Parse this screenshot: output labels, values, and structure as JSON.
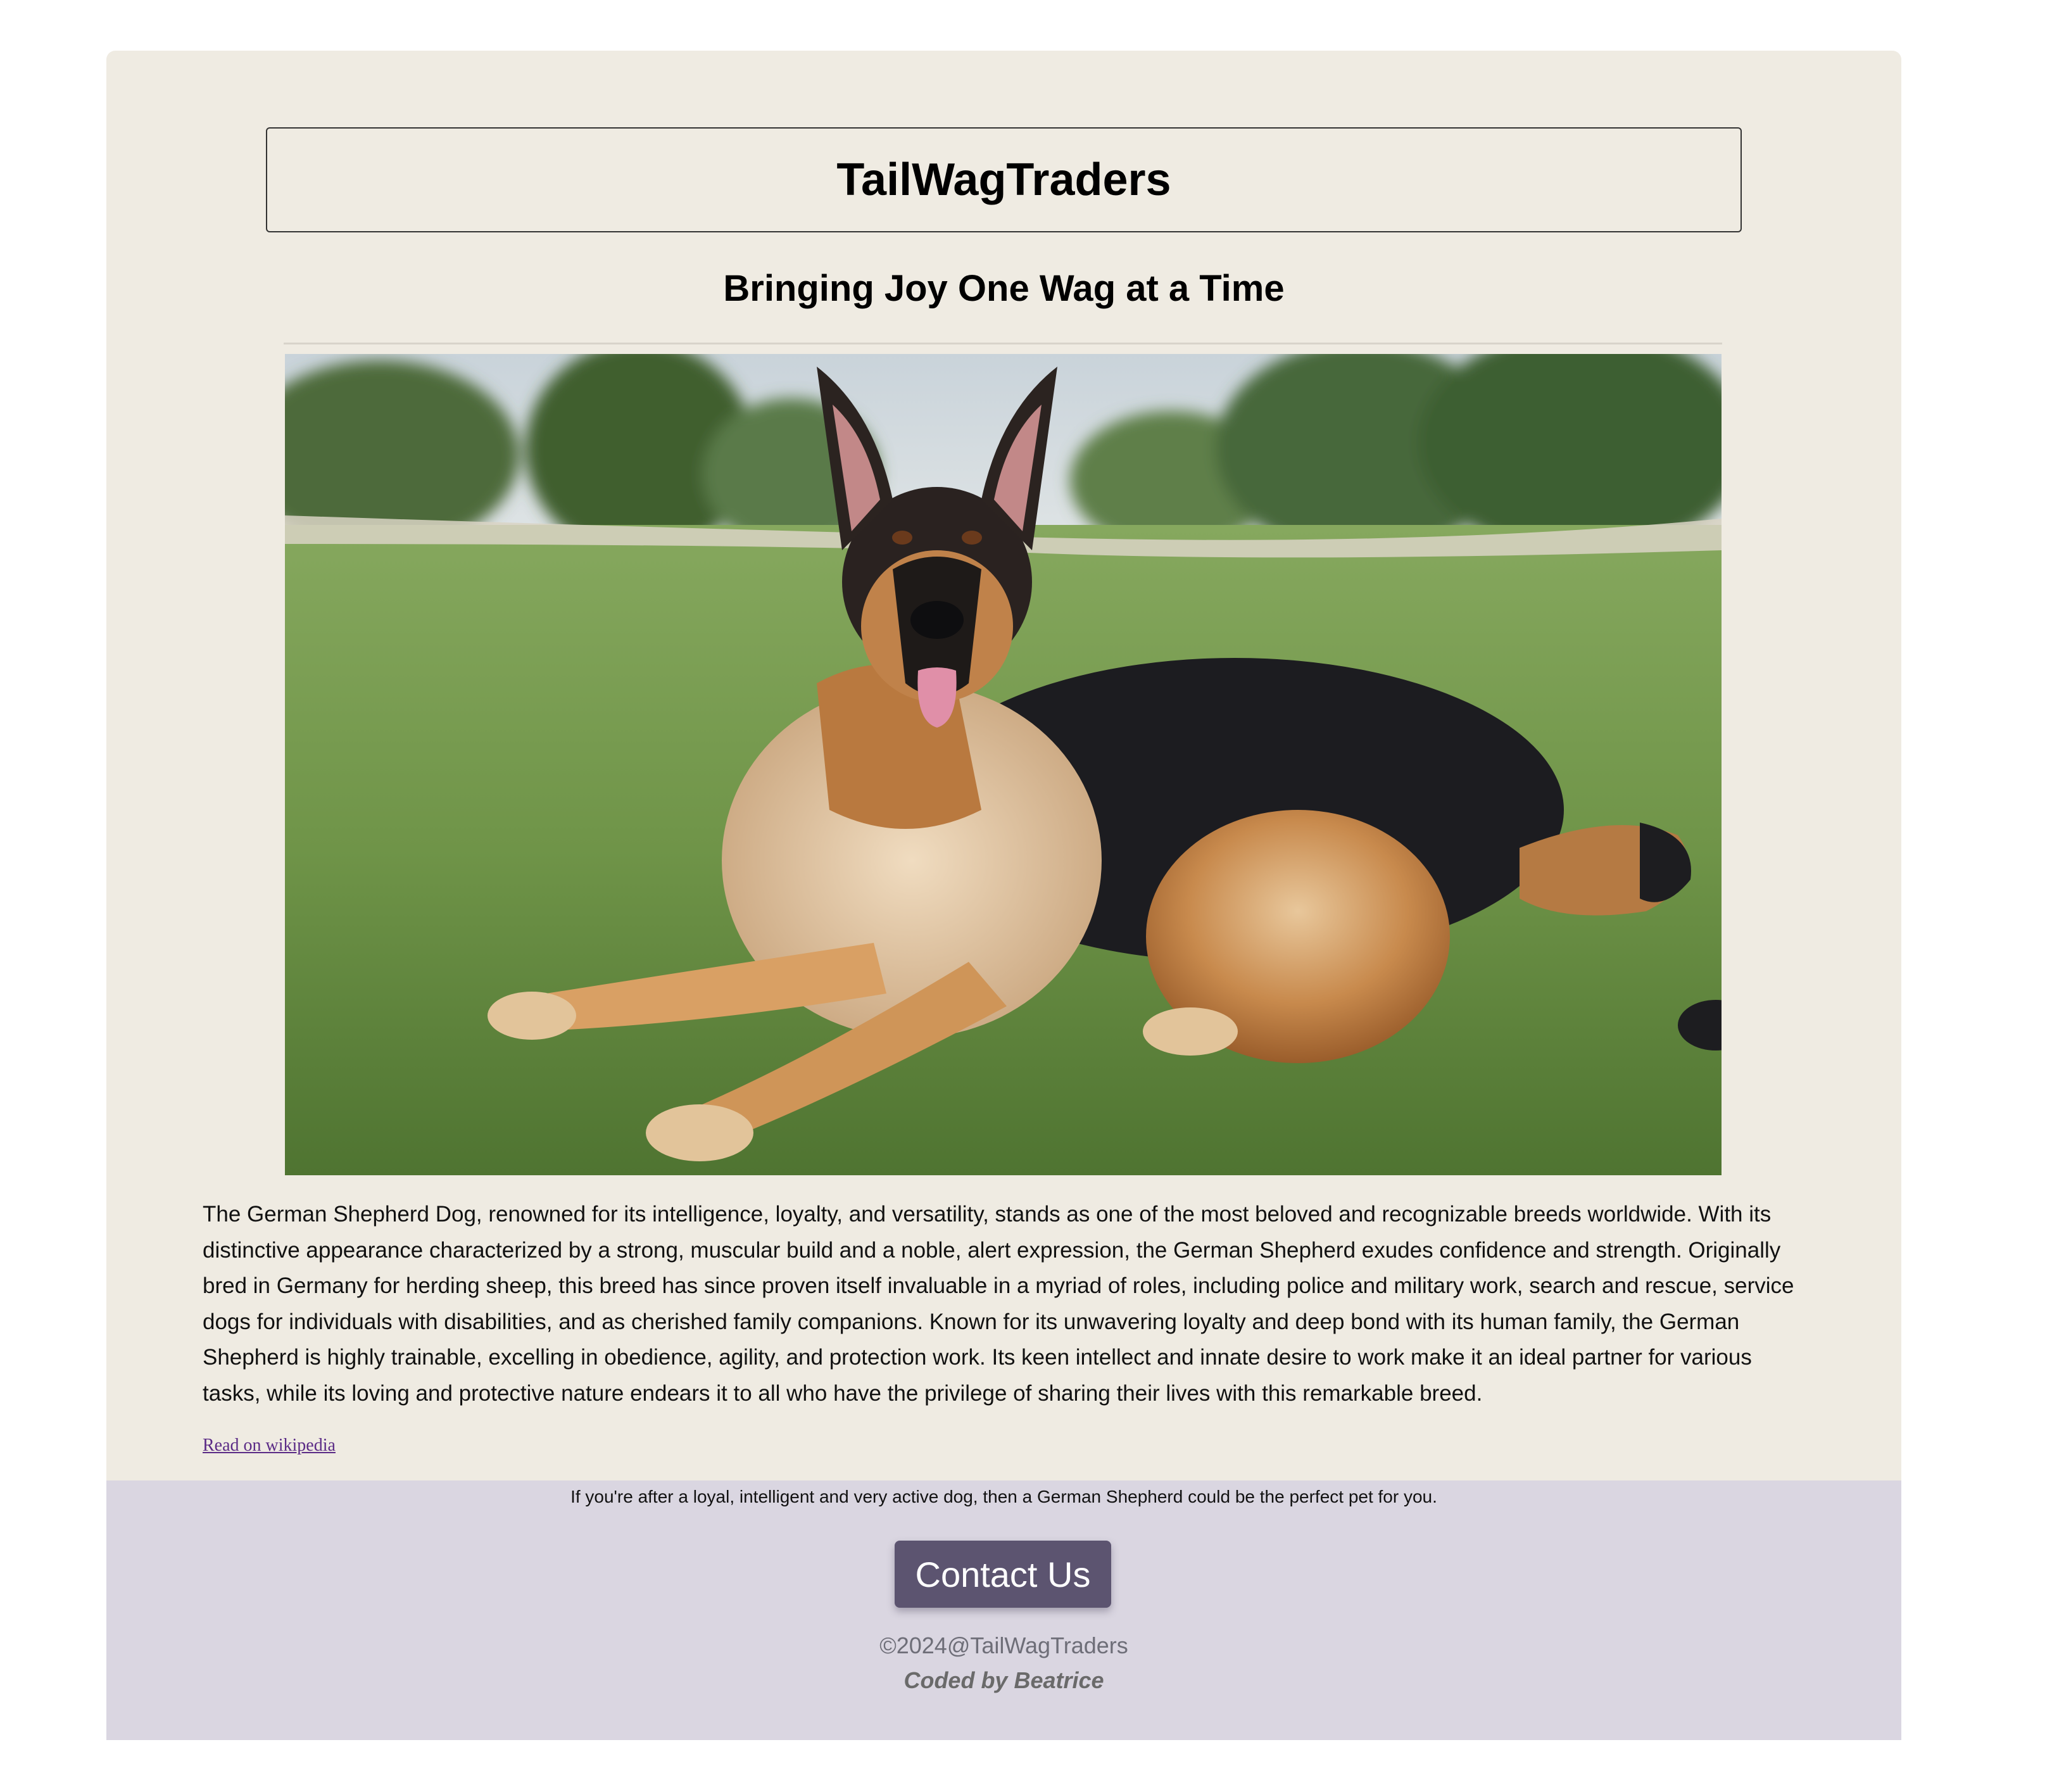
{
  "header": {
    "brand": "TailWagTraders",
    "tagline": "Bringing Joy One Wag at a Time"
  },
  "hero": {
    "alt": "German Shepherd dog lying on grass"
  },
  "main": {
    "description": "The German Shepherd Dog, renowned for its intelligence, loyalty, and versatility, stands as one of the most beloved and recognizable breeds worldwide. With its distinctive appearance characterized by a strong, muscular build and a noble, alert expression, the German Shepherd exudes confidence and strength. Originally bred in Germany for herding sheep, this breed has since proven itself invaluable in a myriad of roles, including police and military work, search and rescue, service dogs for individuals with disabilities, and as cherished family companions. Known for its unwavering loyalty and deep bond with its human family, the German Shepherd is highly trainable, excelling in obedience, agility, and protection work. Its keen intellect and innate desire to work make it an ideal partner for various tasks, while its loving and protective nature endears it to all who have the privilege of sharing their lives with this remarkable breed.",
    "wiki_link": "Read on wikipedia"
  },
  "footer": {
    "note": "If you're after a loyal, intelligent and very active dog, then a German Shepherd could be the perfect pet for you.",
    "contact_label": "Contact Us",
    "copyright": "©2024@TailWagTraders",
    "credit": "Coded by Beatrice"
  },
  "colors": {
    "page_background": "#ffffff",
    "card_background": "#efebe2",
    "footer_background": "#dad6e1",
    "button_background": "#5c5470",
    "link_color": "#5b2b86"
  }
}
